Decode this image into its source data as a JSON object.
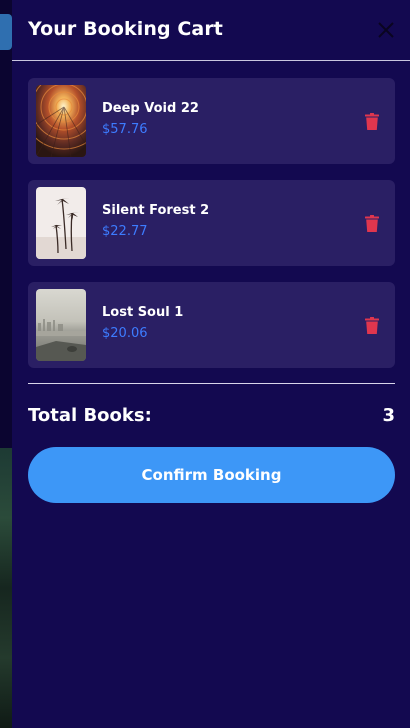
{
  "drawer": {
    "title": "Your Booking Cart",
    "close_icon": "close-icon"
  },
  "cart": {
    "items": [
      {
        "title": "Deep Void 22",
        "price": "$57.76",
        "thumb": "spiral-architecture"
      },
      {
        "title": "Silent Forest 2",
        "price": "$22.77",
        "thumb": "palm-trees"
      },
      {
        "title": "Lost Soul 1",
        "price": "$20.06",
        "thumb": "foggy-shoreline"
      }
    ],
    "delete_icon": "trash-icon"
  },
  "summary": {
    "total_label": "Total Books:",
    "total_value": "3"
  },
  "actions": {
    "confirm_label": "Confirm Booking"
  },
  "colors": {
    "background": "#130950",
    "card": "#2a1f64",
    "price": "#3d7cff",
    "delete": "#e0364e",
    "button": "#3d97f7"
  }
}
